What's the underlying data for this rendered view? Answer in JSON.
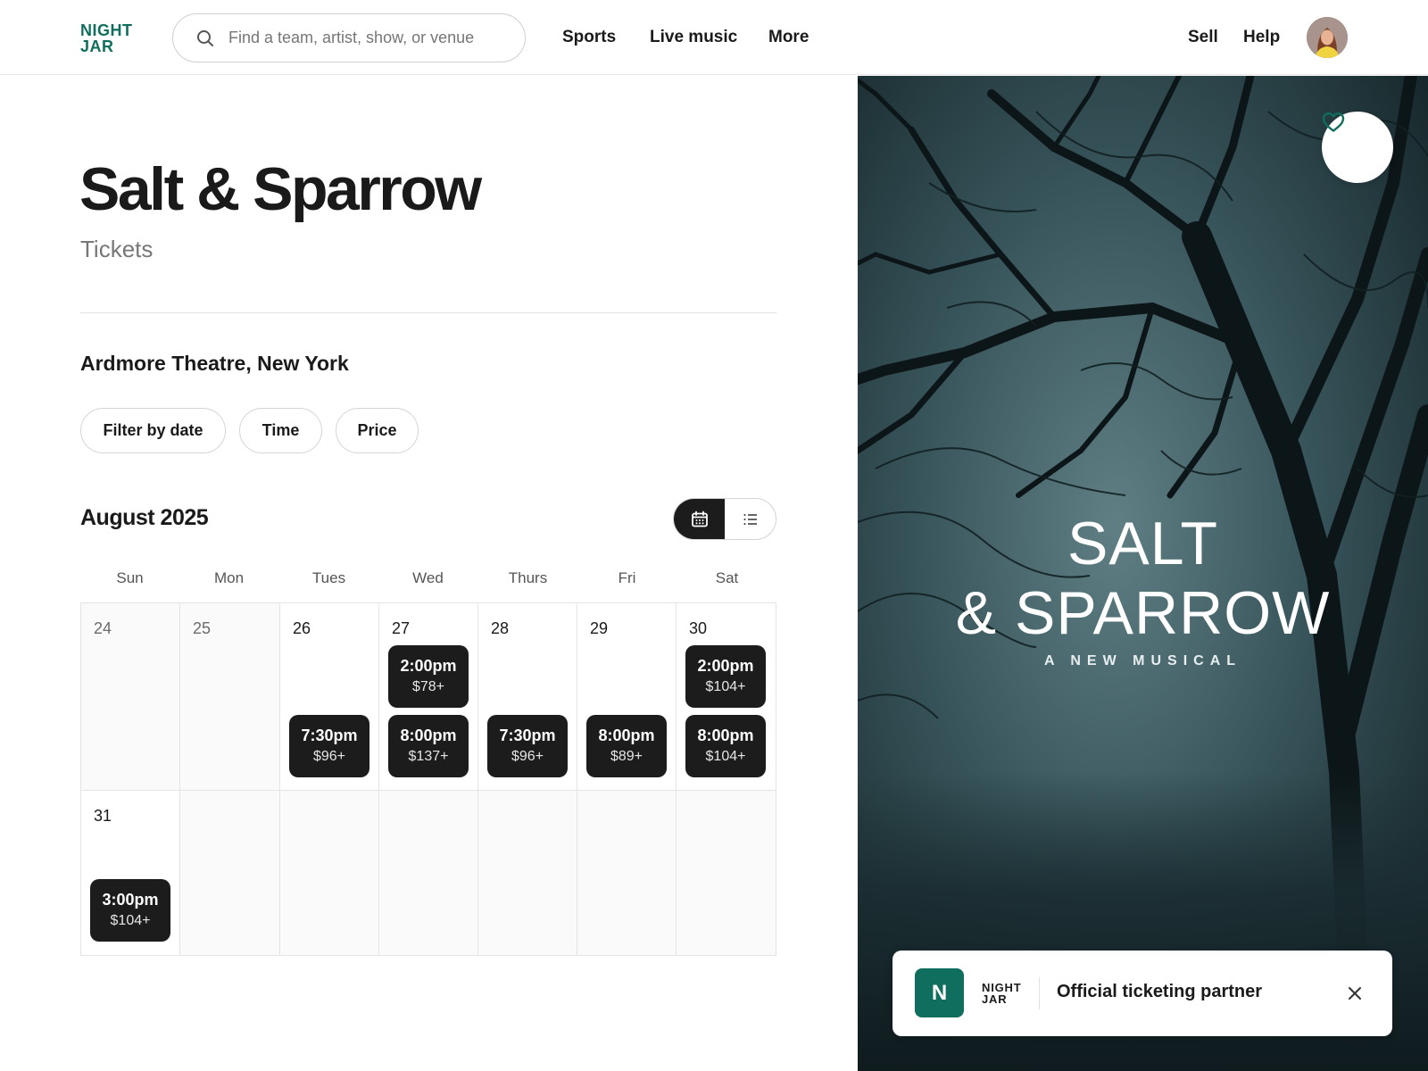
{
  "header": {
    "logo_line1": "NIGHT",
    "logo_line2": "JAR",
    "search_placeholder": "Find a team, artist, show, or venue",
    "nav": [
      "Sports",
      "Live music",
      "More"
    ],
    "right_nav": [
      "Sell",
      "Help"
    ]
  },
  "event": {
    "title": "Salt & Sparrow",
    "subtitle": "Tickets",
    "venue": "Ardmore Theatre, New York"
  },
  "filters": [
    "Filter by date",
    "Time",
    "Price"
  ],
  "calendar": {
    "month": "August 2025",
    "weekdays": [
      "Sun",
      "Mon",
      "Tues",
      "Wed",
      "Thurs",
      "Fri",
      "Sat"
    ],
    "days": [
      "24",
      "25",
      "26",
      "27",
      "28",
      "29",
      "30",
      "31"
    ],
    "slots": {
      "d26_evening": {
        "time": "7:30pm",
        "price": "$96+"
      },
      "d27_matinee": {
        "time": "2:00pm",
        "price": "$78+"
      },
      "d27_evening": {
        "time": "8:00pm",
        "price": "$137+"
      },
      "d28_evening": {
        "time": "7:30pm",
        "price": "$96+"
      },
      "d29_evening": {
        "time": "8:00pm",
        "price": "$89+"
      },
      "d30_matinee": {
        "time": "2:00pm",
        "price": "$104+"
      },
      "d30_evening": {
        "time": "8:00pm",
        "price": "$104+"
      },
      "d31_matinee": {
        "time": "3:00pm",
        "price": "$104+"
      }
    }
  },
  "hero": {
    "line1": "SALT",
    "line2": "& SPARROW",
    "tagline": "A NEW MUSICAL"
  },
  "partner": {
    "badge": "N",
    "logo_line1": "NIGHT",
    "logo_line2": "JAR",
    "text": "Official ticketing partner"
  },
  "colors": {
    "brand": "#0f6e5e",
    "slot_bg": "#1c1c1c"
  }
}
